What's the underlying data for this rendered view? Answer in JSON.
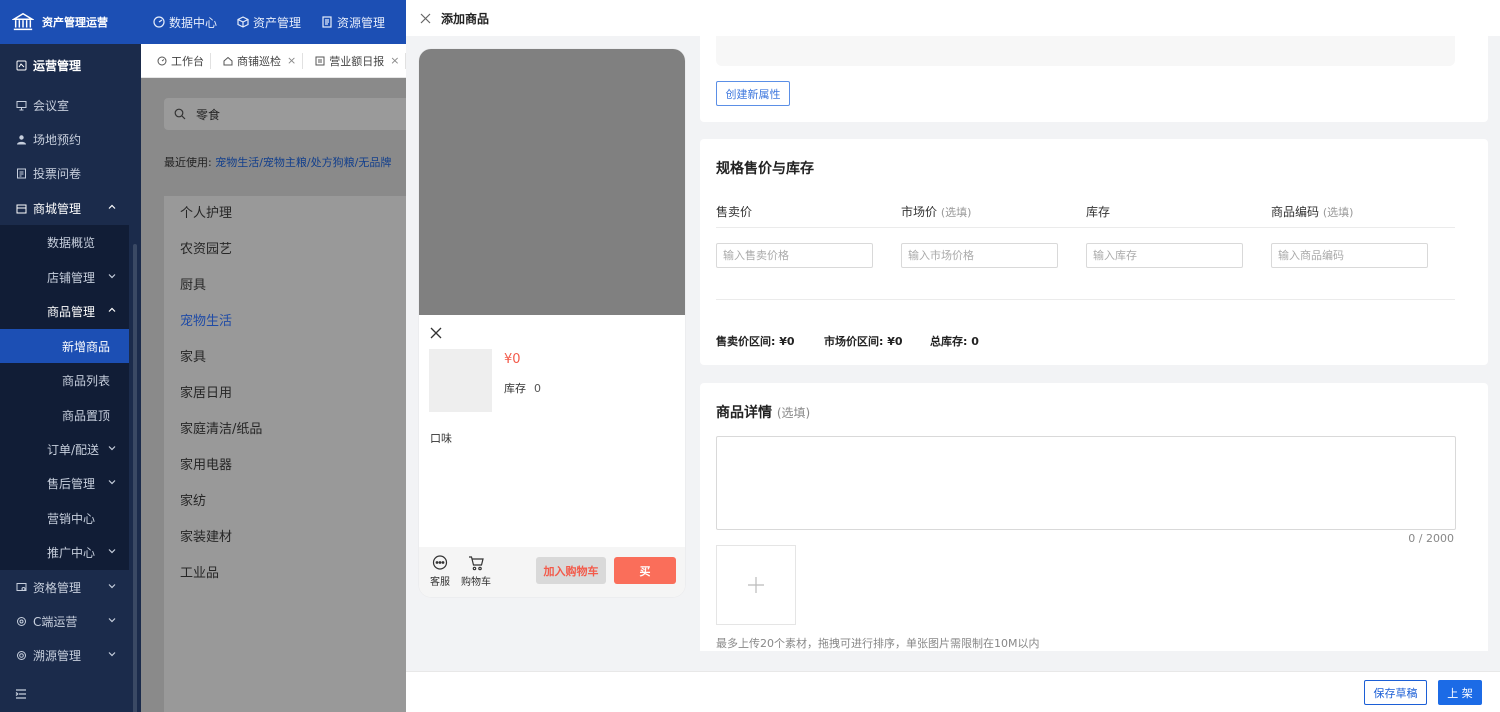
{
  "app": {
    "title": "资产管理运营"
  },
  "topnav": [
    {
      "label": "数据中心",
      "icon": "dashboard-icon"
    },
    {
      "label": "资产管理",
      "icon": "cube-icon"
    },
    {
      "label": "资源管理",
      "icon": "document-icon"
    }
  ],
  "sidebar": {
    "section_title": "运营管理",
    "items": {
      "meeting": "会议室",
      "venue": "场地预约",
      "vote": "投票问卷",
      "mall": "商城管理",
      "data_overview": "数据概览",
      "store": "店铺管理",
      "product": "商品管理",
      "new_product": "新增商品",
      "product_list": "商品列表",
      "product_top": "商品置顶",
      "order": "订单/配送",
      "aftersale": "售后管理",
      "marketing": "营销中心",
      "promotion": "推广中心",
      "qualification": "资格管理",
      "c_ops": "C端运营",
      "trace": "溯源管理"
    }
  },
  "tabs": [
    {
      "label": "工作台",
      "closable": false
    },
    {
      "label": "商铺巡检",
      "closable": true
    },
    {
      "label": "营业额日报",
      "closable": true
    }
  ],
  "background": {
    "search_value": "零食",
    "recent_label": "最近使用:",
    "recent_path": "宠物生活/宠物主粮/处方狗粮/无品牌",
    "categories": [
      "个人护理",
      "农资园艺",
      "厨具",
      "宠物生活",
      "家具",
      "家居日用",
      "家庭清洁/纸品",
      "家用电器",
      "家纺",
      "家装建材",
      "工业品"
    ],
    "selected_category": "宠物生活"
  },
  "drawer": {
    "title": "添加商品",
    "footer": {
      "draft": "保存草稿",
      "publish": "上 架"
    }
  },
  "preview": {
    "price": "¥0",
    "stock_label": "库存",
    "stock_value": "0",
    "flavor_label": "口味",
    "service_label": "客服",
    "cart_label": "购物车",
    "add_cart": "加入购物车",
    "buy": "买"
  },
  "attributes": {
    "create_button": "创建新属性"
  },
  "pricing": {
    "title": "规格售价与库存",
    "columns": [
      {
        "label": "售卖价",
        "optional": "",
        "placeholder": "输入售卖价格"
      },
      {
        "label": "市场价",
        "optional": "(选填)",
        "placeholder": "输入市场价格"
      },
      {
        "label": "库存",
        "optional": "",
        "placeholder": "输入库存"
      },
      {
        "label": "商品编码",
        "optional": "(选填)",
        "placeholder": "输入商品编码"
      }
    ],
    "summary": {
      "sale_range_label": "售卖价区间:",
      "sale_range_value": "¥0",
      "market_range_label": "市场价区间:",
      "market_range_value": "¥0",
      "total_stock_label": "总库存:",
      "total_stock_value": "0"
    }
  },
  "details": {
    "title": "商品详情",
    "optional": "(选填)",
    "counter": "0 / 2000",
    "upload_hint": "最多上传20个素材，拖拽可进行排序，单张图片需限制在10M以内"
  },
  "colors": {
    "brand": "#1c4fb4",
    "sidebar": "#1b2b4b",
    "price": "#f35a4a",
    "buy": "#fa6e5a",
    "primary": "#1c6be6"
  }
}
